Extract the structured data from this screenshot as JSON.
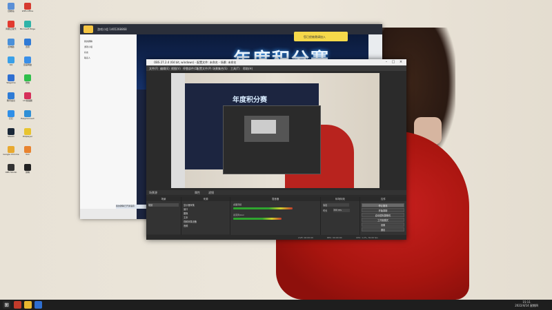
{
  "desktop_icons": [
    {
      "label": "回收站",
      "color": "#5b8fd6"
    },
    {
      "label": "网易云音乐",
      "color": "#e23a2f"
    },
    {
      "label": "此电脑",
      "color": "#4a90d9"
    },
    {
      "label": "QQ",
      "color": "#3aa0e8"
    },
    {
      "label": "Wegame",
      "color": "#2f6fd1"
    },
    {
      "label": "腾讯会议",
      "color": "#2e7bd6"
    },
    {
      "label": "钉钉",
      "color": "#2f8fe8"
    },
    {
      "label": "Steam",
      "color": "#1b2838"
    },
    {
      "label": "Google Chrome",
      "color": "#e8a92f"
    },
    {
      "label": "OBS Studio",
      "color": "#333333"
    },
    {
      "label": "WPS Office",
      "color": "#d63a2f"
    },
    {
      "label": "Microsoft Edge",
      "color": "#2fb3a8"
    },
    {
      "label": "迅雷",
      "color": "#2f7ad6"
    },
    {
      "label": "百度网盘",
      "color": "#3a8fe8"
    },
    {
      "label": "微信",
      "color": "#2fbf4a"
    },
    {
      "label": "UU加速器",
      "color": "#d62f5a"
    },
    {
      "label": "EasyConnect",
      "color": "#2f8fd6"
    },
    {
      "label": "Potplayer",
      "color": "#e8c42f"
    },
    {
      "label": "VLC",
      "color": "#e8832f"
    },
    {
      "label": "剪映",
      "color": "#222222"
    }
  ],
  "qq": {
    "title": "游戏小组 1465268868",
    "notification": "您已经被邀请加入",
    "banner_text": "年度积分赛",
    "sidebar": [
      "我的群聊",
      "游戏小组",
      "好友",
      "联系人"
    ],
    "status_text": "我的群聊已开通语音"
  },
  "obs": {
    "title": "OBS 27.2.4 (64 bit, windows) - 配置文件: 未命名 - 场景: 未命名",
    "menu": [
      "文件(F)",
      "编辑(E)",
      "视图(V)",
      "停靠部件(D)",
      "配置文件(P)",
      "场景集合(S)",
      "工具(T)",
      "帮助(H)"
    ],
    "preview_label": "年度积分赛",
    "toolbar_left": "场景源",
    "toolbar_props": "属性",
    "toolbar_filters": "滤镜",
    "docks": {
      "scenes_title": "场景",
      "sources_title": "来源",
      "mixer_title": "混音器",
      "transitions_title": "转场特效",
      "controls_title": "控件"
    },
    "scene_name": "场景",
    "sources": [
      "显示器采集",
      "窗口",
      "图像",
      "文本",
      "视频采集设备",
      "音频"
    ],
    "mixer": [
      {
        "label": "桌面音频",
        "level": 0.72
      },
      {
        "label": "麦克风/Aux",
        "level": 0.58
      }
    ],
    "transition": "淡出",
    "duration_label": "时长",
    "duration_value": "300 ms",
    "controls": [
      "停止推流",
      "开始录制",
      "启动虚拟摄像机",
      "工作室模式",
      "设置",
      "退出"
    ],
    "statusbar": [
      "LIVE: 00:00:00",
      "REC: 00:00:00",
      "CPU: 1.2%, 30.00 fps"
    ]
  },
  "taskbar": {
    "time": "15:11",
    "date": "2022/4/14 星期四"
  }
}
